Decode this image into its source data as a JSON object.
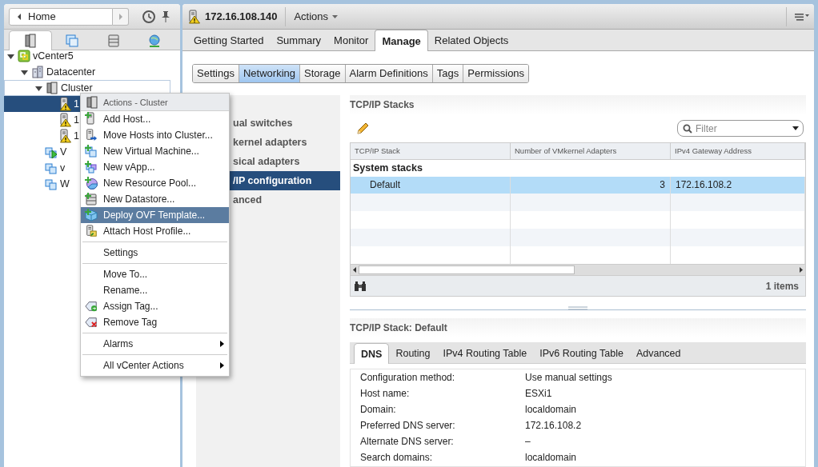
{
  "navigator": {
    "home": "Home",
    "tabs": [
      {
        "kind": "hosts",
        "selected": true
      },
      {
        "kind": "vms",
        "selected": false
      },
      {
        "kind": "storage",
        "selected": false
      },
      {
        "kind": "network",
        "selected": false
      }
    ]
  },
  "tree": [
    {
      "label": "vCenter5",
      "kind": "vcenter",
      "expanded": true,
      "selected": false,
      "focused": false,
      "children": [
        {
          "label": "Datacenter",
          "kind": "datacenter",
          "expanded": true,
          "selected": false,
          "focused": false,
          "children": [
            {
              "label": "Cluster",
              "kind": "cluster",
              "expanded": true,
              "selected": false,
              "focused": true,
              "children": [
                {
                  "label": "1",
                  "kind": "host-warning",
                  "selected": true,
                  "focused": false
                },
                {
                  "label": "1",
                  "kind": "host-warning",
                  "selected": false,
                  "focused": false
                },
                {
                  "label": "1",
                  "kind": "host-warning",
                  "selected": false,
                  "focused": false
                }
              ]
            },
            {
              "label": "V",
              "kind": "vm-running",
              "selected": false,
              "focused": false
            },
            {
              "label": "v",
              "kind": "vm",
              "selected": false,
              "focused": false
            },
            {
              "label": "W",
              "kind": "vm",
              "selected": false,
              "focused": false
            }
          ]
        }
      ]
    }
  ],
  "context_menu": {
    "title": "Actions - Cluster",
    "groups": [
      [
        {
          "label": "Add Host...",
          "kind": "add-host",
          "highlighted": false,
          "submenu": false
        },
        {
          "label": "Move Hosts into Cluster...",
          "kind": "move-hosts",
          "highlighted": false,
          "submenu": false
        },
        {
          "label": "New Virtual Machine...",
          "kind": "new-vm",
          "highlighted": false,
          "submenu": false
        },
        {
          "label": "New vApp...",
          "kind": "new-vapp",
          "highlighted": false,
          "submenu": false
        },
        {
          "label": "New Resource Pool...",
          "kind": "new-pool",
          "highlighted": false,
          "submenu": false
        },
        {
          "label": "New Datastore...",
          "kind": "new-datastore",
          "highlighted": false,
          "submenu": false
        },
        {
          "label": "Deploy OVF Template...",
          "kind": "deploy-ovf",
          "highlighted": true,
          "submenu": false
        },
        {
          "label": "Attach Host Profile...",
          "kind": "host-profile",
          "highlighted": false,
          "submenu": false
        }
      ],
      [
        {
          "label": "Settings",
          "kind": "none",
          "highlighted": false,
          "submenu": false
        }
      ],
      [
        {
          "label": "Move To...",
          "kind": "none",
          "highlighted": false,
          "submenu": false
        },
        {
          "label": "Rename...",
          "kind": "none",
          "highlighted": false,
          "submenu": false
        },
        {
          "label": "Assign Tag...",
          "kind": "assign-tag",
          "highlighted": false,
          "submenu": false
        },
        {
          "label": "Remove Tag",
          "kind": "remove-tag",
          "highlighted": false,
          "submenu": false
        }
      ],
      [
        {
          "label": "Alarms",
          "kind": "none",
          "highlighted": false,
          "submenu": true
        }
      ],
      [
        {
          "label": "All vCenter Actions",
          "kind": "none",
          "highlighted": false,
          "submenu": true
        }
      ]
    ]
  },
  "object_header": {
    "title": "172.16.108.140",
    "actions": "Actions"
  },
  "tabs": [
    {
      "label": "Getting Started",
      "selected": false
    },
    {
      "label": "Summary",
      "selected": false
    },
    {
      "label": "Monitor",
      "selected": false
    },
    {
      "label": "Manage",
      "selected": true
    },
    {
      "label": "Related Objects",
      "selected": false
    }
  ],
  "subtabs": [
    {
      "label": "Settings",
      "selected": false
    },
    {
      "label": "Networking",
      "selected": true
    },
    {
      "label": "Storage",
      "selected": false
    },
    {
      "label": "Alarm Definitions",
      "selected": false
    },
    {
      "label": "Tags",
      "selected": false
    },
    {
      "label": "Permissions",
      "selected": false
    }
  ],
  "networking_nav": [
    {
      "label": "ual switches",
      "selected": false
    },
    {
      "label": "kernel adapters",
      "selected": false
    },
    {
      "label": "sical adapters",
      "selected": false
    },
    {
      "label": "/IP configuration",
      "selected": true
    },
    {
      "label": "anced",
      "selected": false
    }
  ],
  "stacks": {
    "title": "TCP/IP Stacks",
    "filter_placeholder": "Filter",
    "columns": [
      "TCP/IP Stack",
      "Number of VMkernel Adapters",
      "IPv4 Gateway Address"
    ],
    "group": "System stacks",
    "rows": [
      {
        "cells": [
          "Default",
          "3",
          "172.16.108.2"
        ],
        "selected": true
      }
    ],
    "footer": "1 items"
  },
  "detail": {
    "title": "TCP/IP Stack: Default",
    "tabs": [
      {
        "label": "DNS",
        "selected": true
      },
      {
        "label": "Routing",
        "selected": false
      },
      {
        "label": "IPv4 Routing Table",
        "selected": false
      },
      {
        "label": "IPv6 Routing Table",
        "selected": false
      },
      {
        "label": "Advanced",
        "selected": false
      }
    ],
    "fields": [
      {
        "label": "Configuration method:",
        "value": "Use manual settings"
      },
      {
        "label": "Host name:",
        "value": "ESXi1"
      },
      {
        "label": "Domain:",
        "value": "localdomain"
      },
      {
        "label": "Preferred DNS server:",
        "value": "172.16.108.2"
      },
      {
        "label": "Alternate DNS server:",
        "value": "–"
      },
      {
        "label": "Search domains:",
        "value": "localdomain"
      }
    ]
  }
}
